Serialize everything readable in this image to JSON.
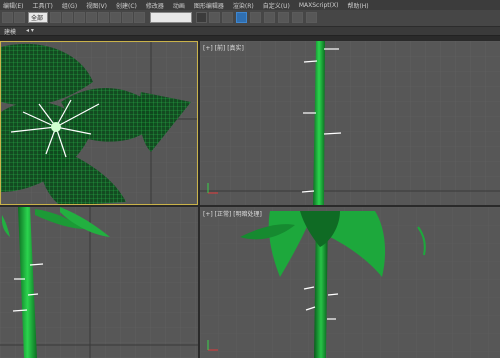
{
  "menubar": {
    "items": [
      "编辑(E)",
      "工具(T)",
      "组(G)",
      "视图(V)",
      "创建(C)",
      "修改器",
      "动画",
      "图形编辑器",
      "渲染(R)",
      "自定义(U)",
      "MAXScript(X)",
      "帮助(H)"
    ]
  },
  "toolbar": {
    "selection_filter": "全部",
    "view_dropdown": "",
    "icons": [
      "undo-icon",
      "redo-icon",
      "link-icon",
      "unlink-icon",
      "select-icon",
      "move-icon",
      "rotate-icon",
      "scale-icon",
      "mirror-icon",
      "align-icon",
      "layer-icon",
      "curve-editor-icon",
      "material-editor-icon",
      "render-setup-icon",
      "render-icon"
    ]
  },
  "ribbon": {
    "label": "建模",
    "dropdown_glyph": "◂ ▾"
  },
  "viewports": {
    "top_left": {
      "label": ""
    },
    "top_right": {
      "label": "[+] [前] [真实]"
    },
    "bottom_left": {
      "label": ""
    },
    "bottom_right": {
      "label": "[+] [正常] [明暗处理]"
    }
  },
  "colors": {
    "viewport_bg": "#575757",
    "grid_line": "#666666",
    "object_green": "#1fa33a",
    "active_border": "#c9b24a"
  }
}
